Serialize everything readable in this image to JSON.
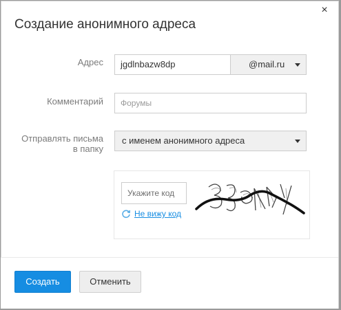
{
  "dialog": {
    "title": "Создание анонимного адреса",
    "close_symbol": "×"
  },
  "form": {
    "address": {
      "label": "Адрес",
      "value": "jgdlnbazw8dp",
      "domain": "@mail.ru"
    },
    "comment": {
      "label": "Комментарий",
      "placeholder": "Форумы"
    },
    "folder": {
      "label_line1": "Отправлять письма",
      "label_line2": "в папку",
      "selected": "с именем анонимного адреса"
    },
    "captcha": {
      "input_placeholder": "Укажите код",
      "refresh_link": "Не вижу код"
    }
  },
  "buttons": {
    "create": "Создать",
    "cancel": "Отменить"
  },
  "colors": {
    "primary": "#168de2",
    "link": "#168de2"
  }
}
